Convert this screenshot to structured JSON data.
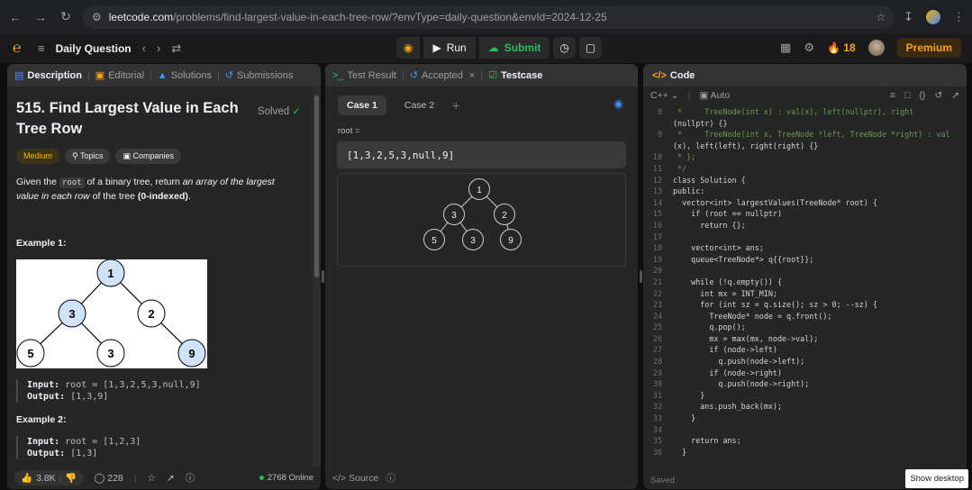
{
  "browser": {
    "url_host": "leetcode.com",
    "url_rest": "/problems/find-largest-value-in-each-tree-row/?envType=daily-question&envId=2024-12-25"
  },
  "nav": {
    "daily_question": "Daily Question",
    "run_label": "Run",
    "submit_label": "Submit",
    "streak": "18",
    "premium": "Premium"
  },
  "description": {
    "tabs": [
      "Description",
      "Editorial",
      "Solutions",
      "Submissions"
    ],
    "title": "515. Find Largest Value in Each Tree Row",
    "solved": "Solved",
    "badges": [
      "Medium",
      "Topics",
      "Companies"
    ],
    "text_1": "Given the ",
    "text_code": "root",
    "text_2": " of a binary tree, return ",
    "text_em": "an array of the largest value in each row",
    "text_3": " of the tree ",
    "text_bold": "(0-indexed)",
    "text_4": ".",
    "example1_heading": "Example 1:",
    "example1_tree_nodes": [
      "1",
      "3",
      "2",
      "5",
      "3",
      "9"
    ],
    "example1_input_label": "Input:",
    "example1_input": "root = [1,3,2,5,3,null,9]",
    "example1_output_label": "Output:",
    "example1_output": "[1,3,9]",
    "example2_heading": "Example 2:",
    "example2_input_label": "Input:",
    "example2_input": "root = [1,2,3]",
    "example2_output_label": "Output:",
    "example2_output": "[1,3]",
    "likes": "3.8K",
    "comments": "228",
    "online": "2768 Online"
  },
  "testcase": {
    "tabs": [
      "Test Result",
      "Accepted",
      "Testcase"
    ],
    "cases": [
      "Case 1",
      "Case 2"
    ],
    "root_label": "root =",
    "input_value": "[1,3,2,5,3,null,9]",
    "tree_nodes": [
      "1",
      "3",
      "2",
      "5",
      "3",
      "9"
    ],
    "source_label": "Source"
  },
  "code": {
    "title": "Code",
    "language": "C++",
    "mode": "Auto",
    "saved": "Saved",
    "show_desktop": "Show desktop",
    "lines": [
      {
        "n": "8",
        "t": " *     TreeNode(int x) : val(x), left(nullptr), right"
      },
      {
        "n": "",
        "t": "(nullptr) {}"
      },
      {
        "n": "9",
        "t": " *     TreeNode(int x, TreeNode *left, TreeNode *right) : val"
      },
      {
        "n": "",
        "t": "(x), left(left), right(right) {}"
      },
      {
        "n": "10",
        "t": " * };"
      },
      {
        "n": "11",
        "t": " */"
      },
      {
        "n": "12",
        "t": "class Solution {"
      },
      {
        "n": "13",
        "t": "public:"
      },
      {
        "n": "14",
        "t": "  vector<int> largestValues(TreeNode* root) {"
      },
      {
        "n": "15",
        "t": "    if (root == nullptr)"
      },
      {
        "n": "16",
        "t": "      return {};"
      },
      {
        "n": "17",
        "t": ""
      },
      {
        "n": "18",
        "t": "    vector<int> ans;"
      },
      {
        "n": "19",
        "t": "    queue<TreeNode*> q{{root}};"
      },
      {
        "n": "20",
        "t": ""
      },
      {
        "n": "21",
        "t": "    while (!q.empty()) {"
      },
      {
        "n": "22",
        "t": "      int mx = INT_MIN;"
      },
      {
        "n": "23",
        "t": "      for (int sz = q.size(); sz > 0; --sz) {"
      },
      {
        "n": "24",
        "t": "        TreeNode* node = q.front();"
      },
      {
        "n": "25",
        "t": "        q.pop();"
      },
      {
        "n": "26",
        "t": "        mx = max(mx, node->val);"
      },
      {
        "n": "27",
        "t": "        if (node->left)"
      },
      {
        "n": "28",
        "t": "          q.push(node->left);"
      },
      {
        "n": "29",
        "t": "        if (node->right)"
      },
      {
        "n": "30",
        "t": "          q.push(node->right);"
      },
      {
        "n": "31",
        "t": "      }"
      },
      {
        "n": "32",
        "t": "      ans.push_back(mx);"
      },
      {
        "n": "33",
        "t": "    }"
      },
      {
        "n": "34",
        "t": ""
      },
      {
        "n": "35",
        "t": "    return ans;"
      },
      {
        "n": "36",
        "t": "  }"
      }
    ]
  },
  "colors": {
    "accent": "#ffa116",
    "success": "#2cbb5d",
    "blue": "#3e91ff",
    "medium": "#ffb800"
  }
}
